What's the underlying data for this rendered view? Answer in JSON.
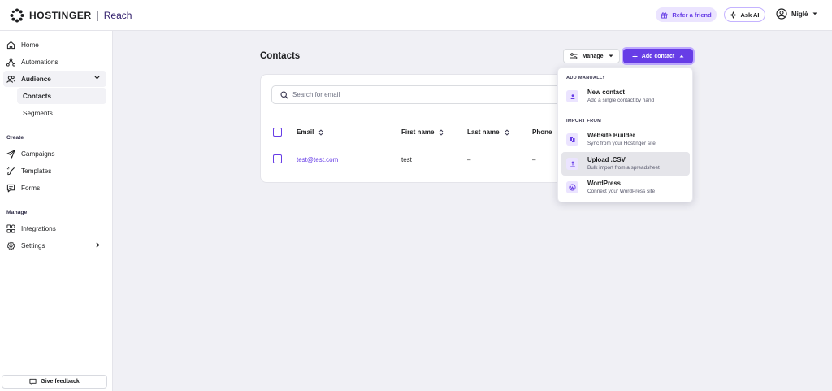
{
  "header": {
    "brand": "HOSTINGER",
    "product": "Reach",
    "refer_label": "Refer a friend",
    "ask_ai_label": "Ask AI",
    "user_name": "Miglė"
  },
  "sidebar": {
    "home": "Home",
    "automations": "Automations",
    "audience": "Audience",
    "contacts": "Contacts",
    "segments": "Segments",
    "section_create": "Create",
    "campaigns": "Campaigns",
    "templates": "Templates",
    "forms": "Forms",
    "section_manage": "Manage",
    "integrations": "Integrations",
    "settings": "Settings",
    "feedback": "Give feedback"
  },
  "main": {
    "title": "Contacts",
    "manage_label": "Manage",
    "add_contact_label": "Add contact",
    "search_placeholder": "Search for email",
    "columns": {
      "email": "Email",
      "first_name": "First name",
      "last_name": "Last name",
      "phone": "Phone"
    },
    "rows": [
      {
        "email": "test@test.com",
        "first_name": "test",
        "last_name": "–",
        "phone": "–"
      }
    ]
  },
  "dropdown": {
    "section_manual": "ADD MANUALLY",
    "section_import": "IMPORT FROM",
    "items": [
      {
        "title": "New contact",
        "desc": "Add a single contact by hand",
        "icon": "person-icon"
      },
      {
        "title": "Website Builder",
        "desc": "Sync from your Hostinger site",
        "icon": "website-builder-icon"
      },
      {
        "title": "Upload .CSV",
        "desc": "Bulk import from a spreadsheet",
        "icon": "upload-icon"
      },
      {
        "title": "WordPress",
        "desc": "Connect your WordPress site",
        "icon": "wordpress-icon"
      }
    ]
  },
  "colors": {
    "accent": "#673de6",
    "accent_light": "#ebe4ff",
    "background": "#f0f0f5"
  }
}
